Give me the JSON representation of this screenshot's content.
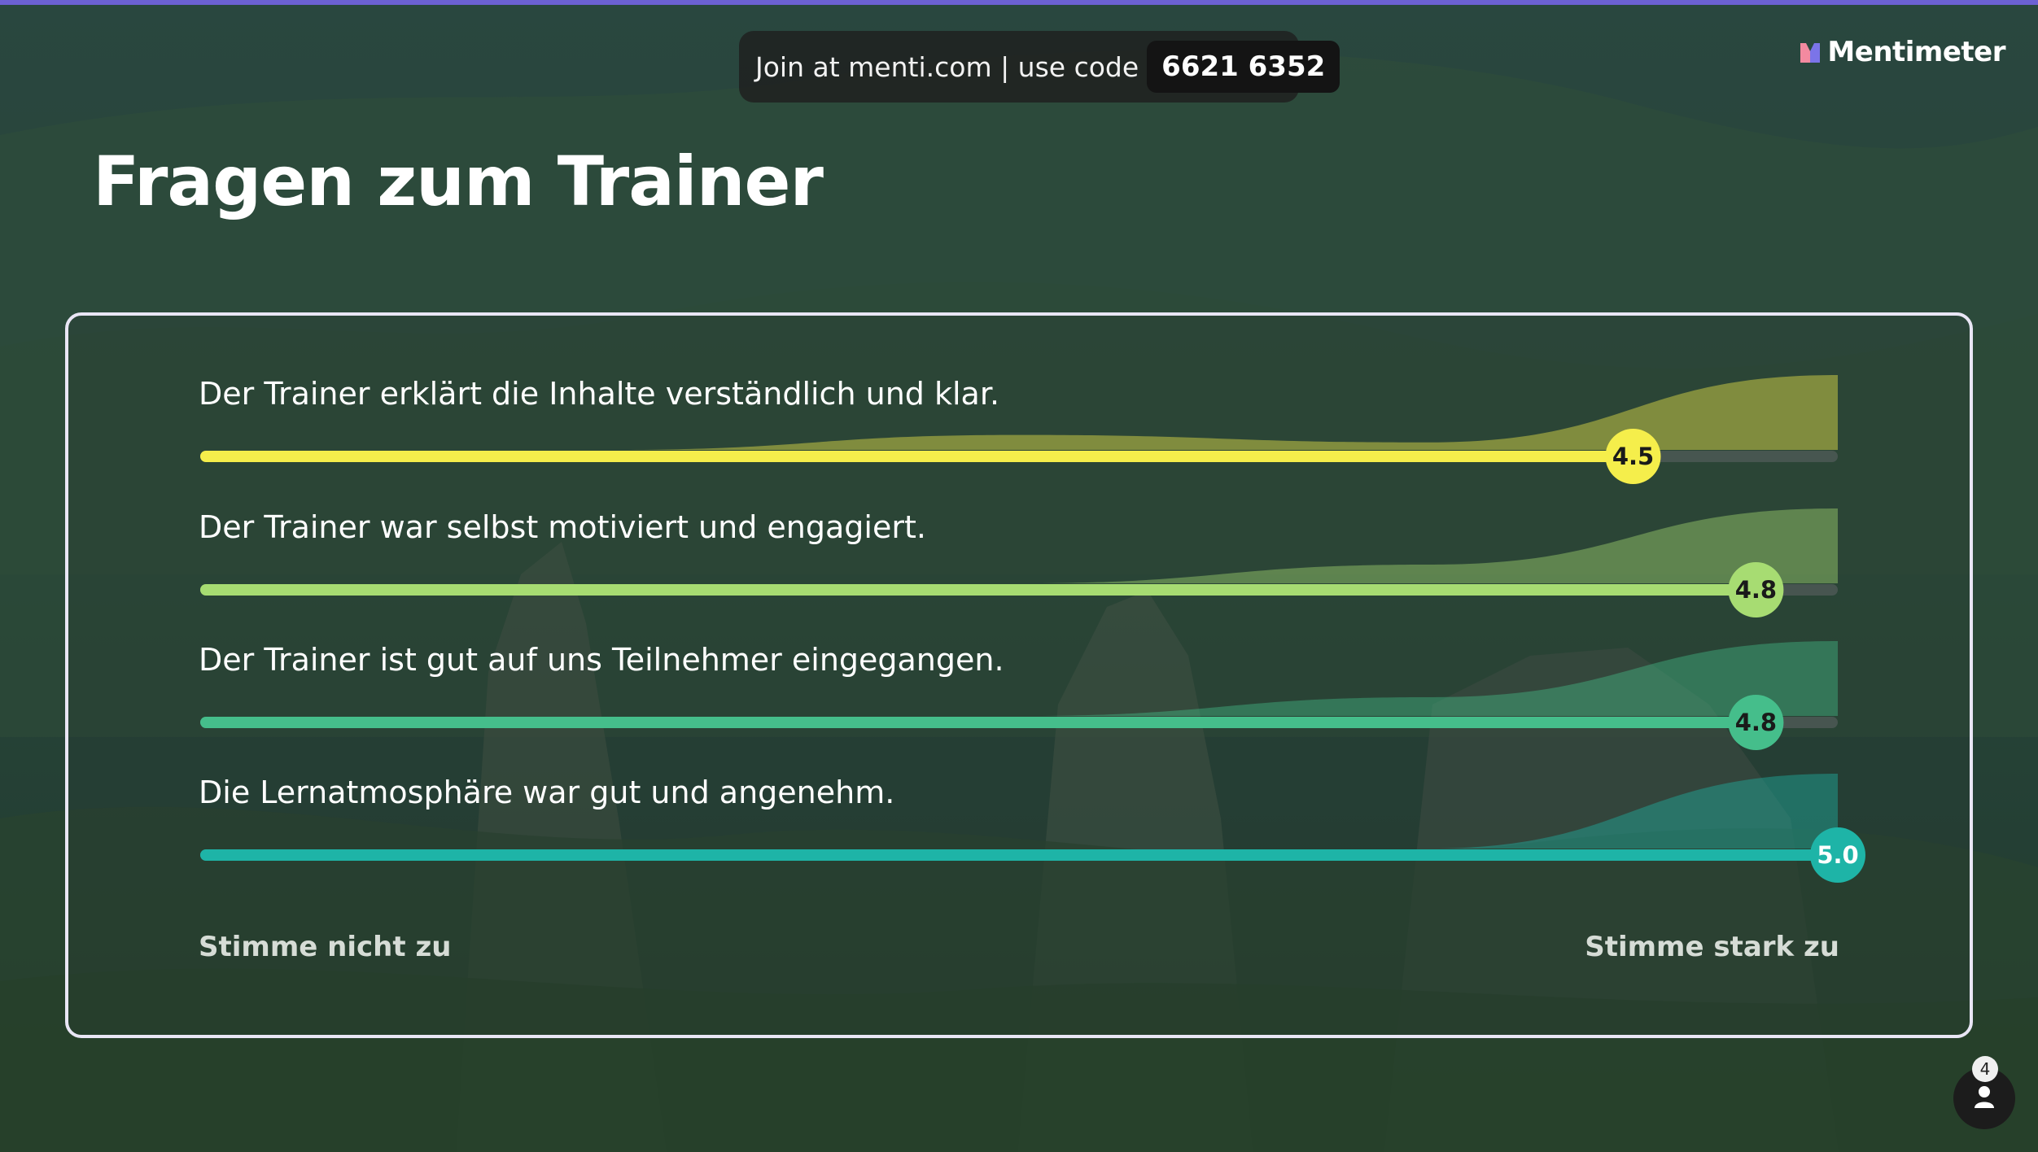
{
  "join": {
    "text": "Join at menti.com | use code",
    "code": "6621 6352"
  },
  "brand": {
    "name": "Mentimeter"
  },
  "title": "Fragen zum Trainer",
  "scale": {
    "min_label": "Stimme nicht zu",
    "max_label": "Stimme stark zu"
  },
  "participants": {
    "count": "4"
  },
  "chart_data": {
    "type": "bar",
    "orientation": "horizontal",
    "scale_min": 1,
    "scale_max": 5,
    "items": [
      {
        "label": "Der Trainer erklärt die Inhalte verständlich und klar.",
        "value": 4.5,
        "value_label": "4.5",
        "color": "#f5ee4b",
        "distribution": [
          0,
          0,
          0.2,
          0.1,
          1.0
        ]
      },
      {
        "label": "Der Trainer war selbst motiviert und engagiert.",
        "value": 4.8,
        "value_label": "4.8",
        "color": "#a7dc72",
        "distribution": [
          0,
          0,
          0,
          0.25,
          1.0
        ]
      },
      {
        "label": "Der Trainer ist gut auf uns Teilnehmer eingegangen.",
        "value": 4.8,
        "value_label": "4.8",
        "color": "#45be8b",
        "distribution": [
          0,
          0,
          0,
          0.25,
          1.0
        ]
      },
      {
        "label": "Die Lernatmosphäre war gut und angenehm.",
        "value": 5.0,
        "value_label": "5.0",
        "color": "#1eb4a7",
        "distribution": [
          0,
          0,
          0,
          0,
          1.0
        ]
      }
    ]
  }
}
